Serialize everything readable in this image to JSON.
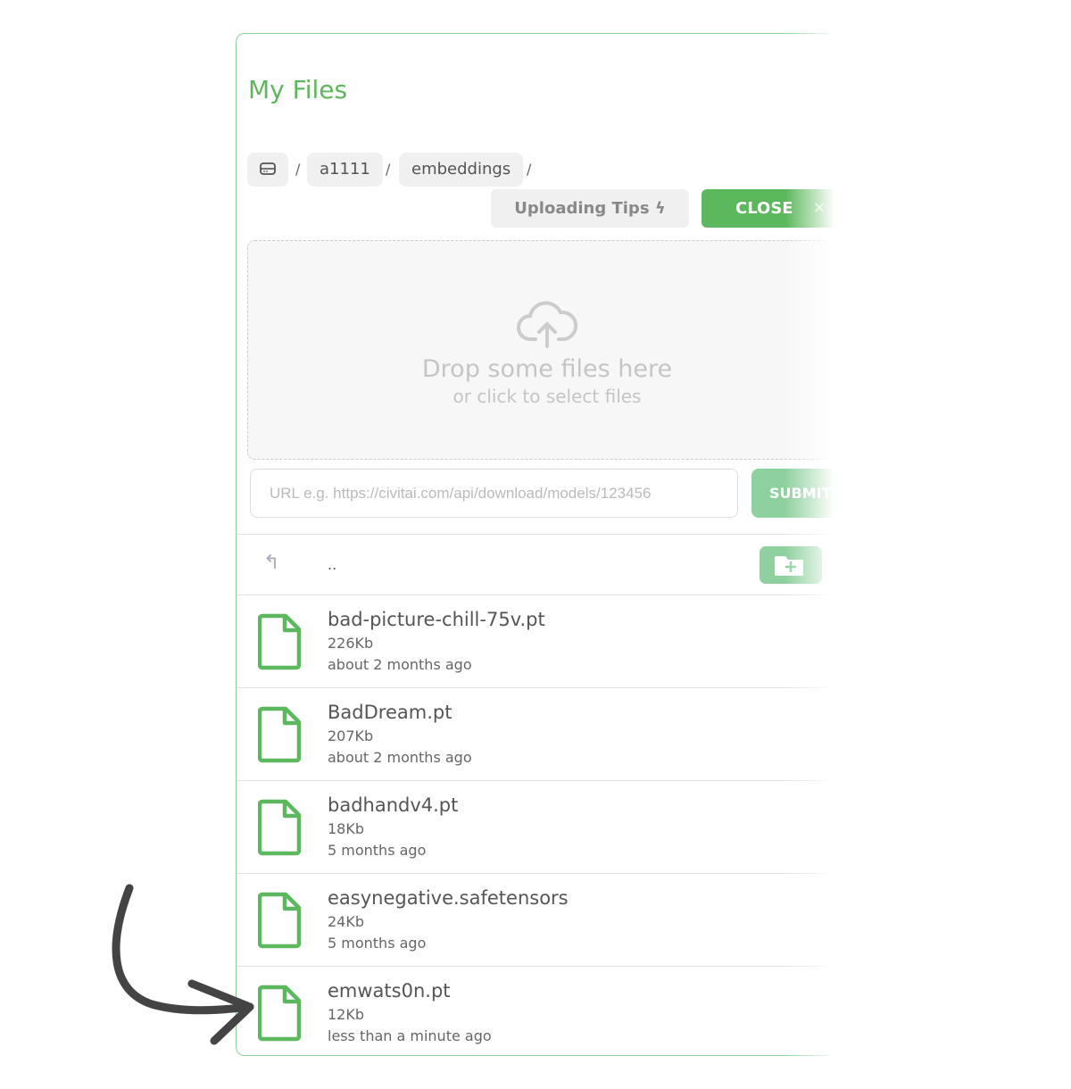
{
  "title": "My Files",
  "breadcrumb": {
    "root_icon": "drive-icon",
    "items": [
      "a1111",
      "embeddings"
    ],
    "separator": "/"
  },
  "buttons": {
    "tips": "Uploading Tips",
    "tips_icon": "bolt-icon",
    "close": "CLOSE",
    "close_icon": "x-icon",
    "submit": "SUBMIT"
  },
  "dropzone": {
    "icon": "cloud-upload-icon",
    "line1": "Drop some files here",
    "line2": "or click to select files"
  },
  "url_input": {
    "placeholder": "URL e.g. https://civitai.com/api/download/models/123456",
    "value": ""
  },
  "parent_dir": "..",
  "colors": {
    "accent": "#5cb85c",
    "accent_light": "#8fd19e"
  },
  "files": [
    {
      "name": "bad-picture-chill-75v.pt",
      "size": "226Kb",
      "modified": "about 2 months ago"
    },
    {
      "name": "BadDream.pt",
      "size": "207Kb",
      "modified": "about 2 months ago"
    },
    {
      "name": "badhandv4.pt",
      "size": "18Kb",
      "modified": "5 months ago"
    },
    {
      "name": "easynegative.safetensors",
      "size": "24Kb",
      "modified": "5 months ago"
    },
    {
      "name": "emwats0n.pt",
      "size": "12Kb",
      "modified": "less than a minute ago"
    }
  ]
}
